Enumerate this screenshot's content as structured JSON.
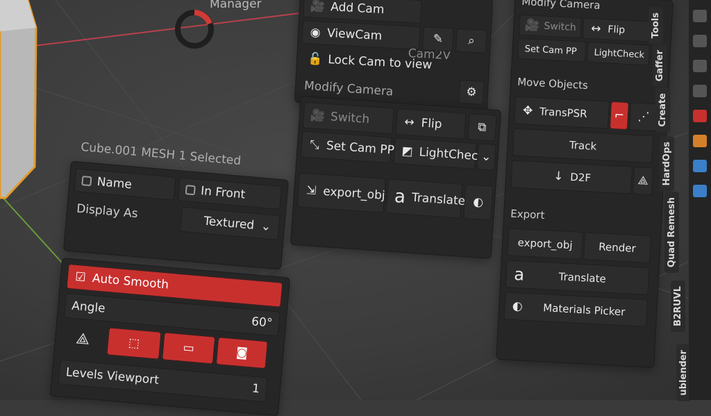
{
  "top_fragment": "Manager",
  "cam_panel": {
    "add_cam": "Add Cam",
    "view_cam": "ViewCam",
    "cam_name": "Cam2V",
    "lock_cam": "Lock Cam to view"
  },
  "modify_camera": {
    "title": "Modify Camera",
    "switch": "Switch",
    "flip": "Flip",
    "set_cam_pp": "Set Cam PP",
    "light_check": "LightCheck"
  },
  "export_row": {
    "export_obj": "export_obj",
    "translate": "Translate"
  },
  "object_panel": {
    "header": "Cube.001 MESH  1 Selected",
    "name": "Name",
    "in_front": "In Front",
    "display_as": "Display As",
    "display_value": "Textured",
    "auto_smooth": "Auto Smooth",
    "angle": "Angle",
    "angle_value": "60°",
    "levels_viewport": "Levels Viewport",
    "levels_value": "1"
  },
  "right_panel": {
    "modify_camera": "Modify Camera",
    "switch": "Switch",
    "flip": "Flip",
    "set_cam_pp": "Set Cam PP",
    "light_check": "LightCheck",
    "move_objects": "Move Objects",
    "trans_psr": "TransPSR",
    "track": "Track",
    "d2f": "D2F",
    "export": "Export",
    "export_obj": "export_obj",
    "render": "Render",
    "translate": "Translate",
    "materials_picker": "Materials Picker"
  },
  "side_tabs": [
    "Tools",
    "Gaffer",
    "Create",
    "HardOps",
    "Quad Remesh",
    "B2RUVL",
    "ublender"
  ],
  "colors": {
    "accent": "#c8302e",
    "panel": "#262626",
    "button": "#2c2c2c",
    "cube_edge": "#e39a2a"
  },
  "icons": [
    "camera-icon",
    "eye-icon",
    "lock-icon",
    "eyedropper-icon",
    "search-icon",
    "gear-icon",
    "flip-icon",
    "collapse-icon",
    "lightcheck-icon",
    "export-icon",
    "translate-icon",
    "material-icon",
    "vertex-icon",
    "monitor-icon",
    "render-camera-icon",
    "move-icon",
    "arrow-down-icon",
    "chevron-down-icon"
  ]
}
